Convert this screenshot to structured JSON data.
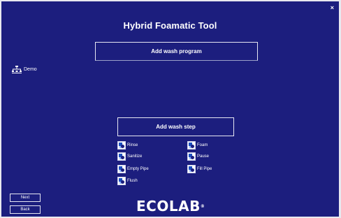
{
  "window": {
    "close_glyph": "×"
  },
  "title": "Hybrid Foamatic Tool",
  "add_program_label": "Add wash program",
  "tree": {
    "icon": "tree-node-icon",
    "label": "Demo"
  },
  "add_step_label": "Add wash step",
  "steps": [
    {
      "label": "Rinse"
    },
    {
      "label": "Foam"
    },
    {
      "label": "Sanitize"
    },
    {
      "label": "Pause"
    },
    {
      "label": "Empty Pipe"
    },
    {
      "label": "Fill Pipe"
    },
    {
      "label": "Flush"
    }
  ],
  "nav": {
    "next_label": "Next",
    "back_label": "Back"
  },
  "logo": {
    "text": "ECOLAB",
    "mark": "®"
  },
  "colors": {
    "background": "#1c1e7e",
    "foreground": "#ffffff"
  }
}
